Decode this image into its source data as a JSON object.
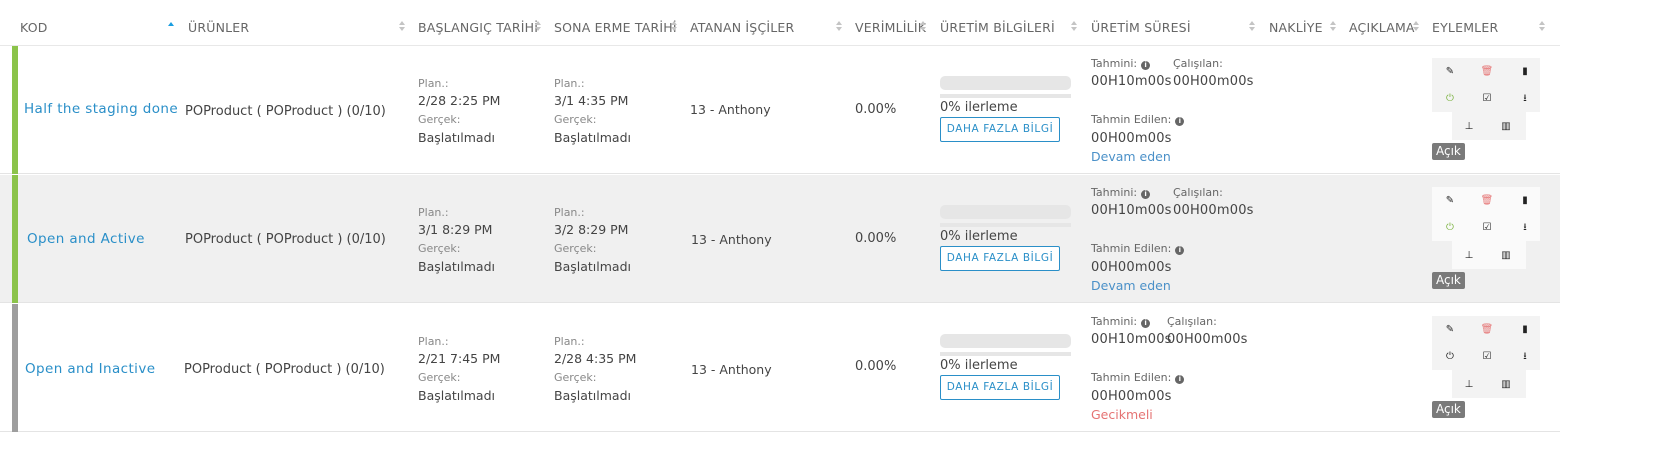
{
  "headers": {
    "kod": "KOD",
    "urunler": "ÜRÜNLER",
    "baslangic": "BAŞLANGIÇ TARİHİ",
    "sona_erme": "SONA ERME TARİHİ",
    "atanan": "ATANAN İŞÇİLER",
    "verimlilik": "VERİMLİLİK",
    "uretim_bilgileri": "ÜRETİM BİLGİLERİ",
    "uretim_suresi": "ÜRETİM SÜRESİ",
    "nakliye": "NAKLİYE",
    "aciklama": "AÇIKLAMA",
    "eylemler": "EYLEMLER"
  },
  "labels": {
    "plan": "Plan.:",
    "gercek": "Gerçek:",
    "tahmini": "Tahmini:",
    "calisilan": "Çalışılan:",
    "tahmin_edilen": "Tahmin Edilen:",
    "more_info": "DAHA FAZLA BİLGİ",
    "open_badge": "Açık"
  },
  "colors": {
    "active_bar": "#8bc34a",
    "inactive_bar": "#9e9e9e",
    "link": "#2a8fc8",
    "status_ongoing": "#4a90c8",
    "status_delayed": "#e57373",
    "delete_icon": "#e57373",
    "power_on_icon": "#7cb342"
  },
  "rows": [
    {
      "code": "Half the staging done",
      "product": "POProduct ( POProduct ) (0/10)",
      "start_plan": "2/28   2:25 PM",
      "start_actual": "Başlatılmadı",
      "end_plan": "3/1   4:35 PM",
      "end_actual": "Başlatılmadı",
      "worker": "13 - Anthony",
      "efficiency": "0.00%",
      "progress": 0,
      "progress_text": "0% ilerleme",
      "estimated": "00H10m00s",
      "worked": "00H00m00s",
      "predicted": "00H00m00s",
      "status": "Devam eden",
      "status_type": "ongoing",
      "active": true
    },
    {
      "code": "Open and Active",
      "product": "POProduct ( POProduct ) (0/10)",
      "start_plan": "3/1   8:29 PM",
      "start_actual": "Başlatılmadı",
      "end_plan": "3/2   8:29 PM",
      "end_actual": "Başlatılmadı",
      "worker": "13 - Anthony",
      "efficiency": "0.00%",
      "progress": 0,
      "progress_text": "0% ilerleme",
      "estimated": "00H10m00s",
      "worked": "00H00m00s",
      "predicted": "00H00m00s",
      "status": "Devam eden",
      "status_type": "ongoing",
      "active": true
    },
    {
      "code": "Open and Inactive",
      "product": "POProduct ( POProduct ) (0/10)",
      "start_plan": "2/21   7:45 PM",
      "start_actual": "Başlatılmadı",
      "end_plan": "2/28   4:35 PM",
      "end_actual": "Başlatılmadı",
      "worker": "13 - Anthony",
      "efficiency": "0.00%",
      "progress": 0,
      "progress_text": "0% ilerleme",
      "estimated": "00H10m00s",
      "worked": "00H00m00s",
      "predicted": "00H00m00s",
      "status": "Gecikmeli",
      "status_type": "delayed",
      "active": false
    }
  ]
}
